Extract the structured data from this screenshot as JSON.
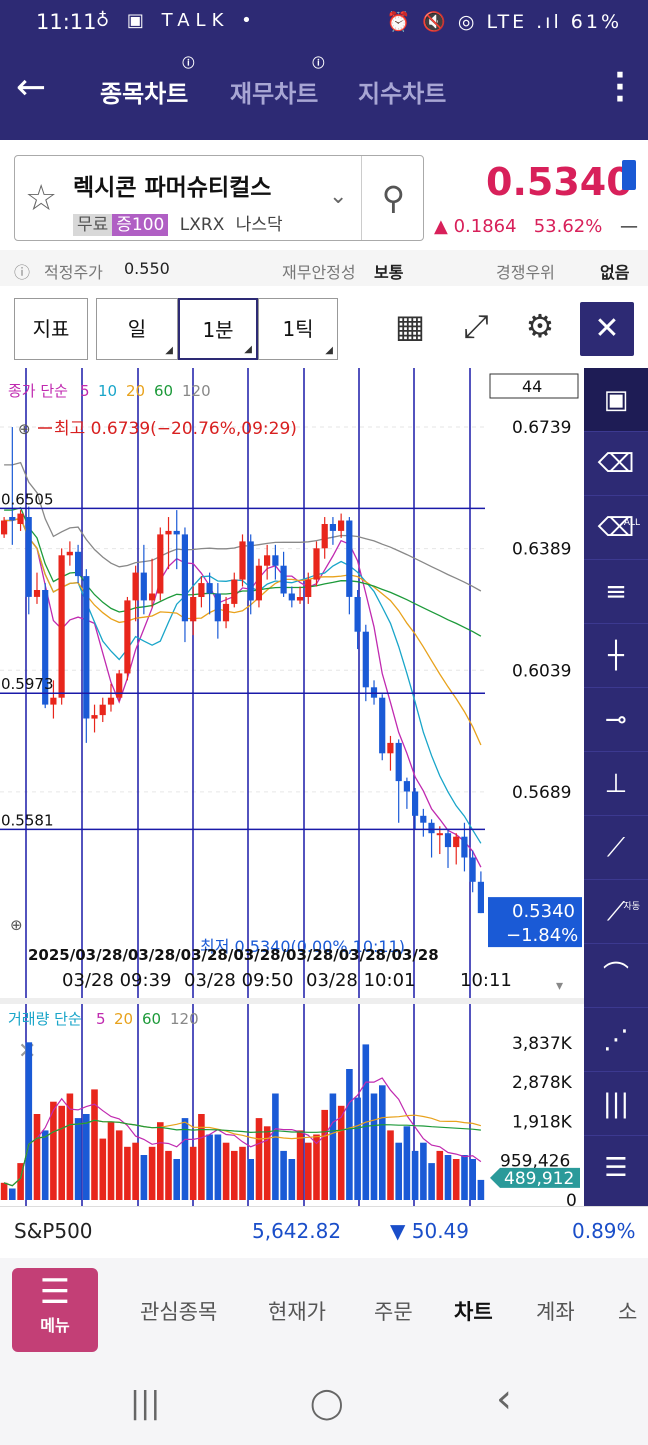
{
  "status": {
    "time": "11:11",
    "left_icons": "♁ ▣ TALK •",
    "right": "⏰ 🔇 ◎ LTE .ıl 61%"
  },
  "header": {
    "tabs": [
      {
        "label": "종목차트",
        "active": true
      },
      {
        "label": "재무차트",
        "active": false
      },
      {
        "label": "지수차트",
        "active": false
      }
    ]
  },
  "stock": {
    "name": "렉시콘 파머슈티컬스",
    "tag1": "무료",
    "tag2": "증100",
    "code": "LXRX",
    "market": "나스닥",
    "price": "0.5340",
    "change": "▲ 0.1864",
    "change_pct": "53.62%",
    "change_dash": "—"
  },
  "info": {
    "fair_label": "적정주가",
    "fair_value": "0.550",
    "stability_label": "재무안정성",
    "stability_value": "보통",
    "compete_label": "경쟁우위",
    "compete_value": "없음"
  },
  "toolbar": {
    "indicator": "지표",
    "day": "일",
    "minute": "1분",
    "tick": "1틱"
  },
  "chart_data": {
    "type": "candlestick",
    "ma_legend": {
      "title": "종가 단순",
      "periods": [
        "5",
        "10",
        "20",
        "60",
        "120"
      ],
      "colors": [
        "#c02ab0",
        "#19a5c9",
        "#e8a21c",
        "#1d9a3a",
        "#888888"
      ]
    },
    "count_box": "44",
    "y_ticks": [
      "0.6739",
      "0.6389",
      "0.6039",
      "0.5689"
    ],
    "ylim": [
      0.5182,
      0.6909
    ],
    "h_lines": [
      {
        "value": 0.6505,
        "label": "0.6505"
      },
      {
        "value": 0.5973,
        "label": "0.5973"
      },
      {
        "value": 0.5581,
        "label": "0.5581"
      }
    ],
    "high_label": "최고 0.6739(−20.76%,09:29)",
    "current_price": "0.5340",
    "current_pct": "−1.84%",
    "date_overlap": "2025/03/28/03/28/03/28/03/28/03/28/03/28/03/28",
    "low_overlap": "최저 0.5340(0.00%,10:11)",
    "x_labels": [
      "03/28 09:39",
      "03/28 09:50",
      "03/28 10:01",
      "10:11"
    ],
    "candles": [
      [
        0.643,
        0.647,
        0.642,
        0.648
      ],
      [
        0.648,
        0.647,
        0.64,
        0.6739
      ],
      [
        0.646,
        0.649,
        0.644,
        0.65
      ],
      [
        0.648,
        0.625,
        0.62,
        0.651
      ],
      [
        0.625,
        0.627,
        0.623,
        0.632
      ],
      [
        0.627,
        0.594,
        0.593,
        0.629
      ],
      [
        0.594,
        0.596,
        0.59,
        0.601
      ],
      [
        0.596,
        0.637,
        0.594,
        0.639
      ],
      [
        0.637,
        0.638,
        0.634,
        0.641
      ],
      [
        0.638,
        0.631,
        0.629,
        0.64
      ],
      [
        0.631,
        0.59,
        0.583,
        0.633
      ],
      [
        0.59,
        0.591,
        0.586,
        0.594
      ],
      [
        0.591,
        0.594,
        0.589,
        0.596
      ],
      [
        0.594,
        0.596,
        0.592,
        0.6
      ],
      [
        0.596,
        0.603,
        0.595,
        0.604
      ],
      [
        0.603,
        0.624,
        0.601,
        0.625
      ],
      [
        0.624,
        0.632,
        0.618,
        0.634
      ],
      [
        0.632,
        0.624,
        0.62,
        0.64
      ],
      [
        0.624,
        0.626,
        0.622,
        0.636
      ],
      [
        0.626,
        0.643,
        0.624,
        0.645
      ],
      [
        0.643,
        0.644,
        0.633,
        0.648
      ],
      [
        0.644,
        0.643,
        0.633,
        0.65
      ],
      [
        0.643,
        0.618,
        0.612,
        0.645
      ],
      [
        0.618,
        0.625,
        0.614,
        0.628
      ],
      [
        0.625,
        0.629,
        0.622,
        0.631
      ],
      [
        0.629,
        0.626,
        0.62,
        0.632
      ],
      [
        0.626,
        0.618,
        0.613,
        0.629
      ],
      [
        0.618,
        0.623,
        0.616,
        0.625
      ],
      [
        0.623,
        0.63,
        0.622,
        0.632
      ],
      [
        0.63,
        0.641,
        0.628,
        0.643
      ],
      [
        0.641,
        0.624,
        0.62,
        0.643
      ],
      [
        0.624,
        0.634,
        0.622,
        0.636
      ],
      [
        0.634,
        0.637,
        0.63,
        0.64
      ],
      [
        0.637,
        0.634,
        0.63,
        0.64
      ],
      [
        0.634,
        0.626,
        0.625,
        0.638
      ],
      [
        0.626,
        0.624,
        0.622,
        0.628
      ],
      [
        0.624,
        0.625,
        0.623,
        0.628
      ],
      [
        0.625,
        0.63,
        0.623,
        0.632
      ],
      [
        0.63,
        0.639,
        0.628,
        0.641
      ],
      [
        0.639,
        0.646,
        0.636,
        0.648
      ],
      [
        0.646,
        0.644,
        0.64,
        0.648
      ],
      [
        0.644,
        0.647,
        0.642,
        0.649
      ],
      [
        0.647,
        0.625,
        0.62,
        0.648
      ],
      [
        0.625,
        0.615,
        0.61,
        0.627
      ],
      [
        0.615,
        0.599,
        0.595,
        0.617
      ],
      [
        0.599,
        0.596,
        0.594,
        0.601
      ],
      [
        0.596,
        0.58,
        0.578,
        0.597
      ],
      [
        0.58,
        0.583,
        0.575,
        0.585
      ],
      [
        0.583,
        0.572,
        0.56,
        0.584
      ],
      [
        0.572,
        0.569,
        0.564,
        0.573
      ],
      [
        0.569,
        0.562,
        0.558,
        0.57
      ],
      [
        0.562,
        0.56,
        0.556,
        0.564
      ],
      [
        0.56,
        0.557,
        0.55,
        0.561
      ],
      [
        0.557,
        0.557,
        0.551,
        0.559
      ],
      [
        0.557,
        0.553,
        0.547,
        0.558
      ],
      [
        0.553,
        0.556,
        0.548,
        0.557
      ],
      [
        0.556,
        0.55,
        0.546,
        0.56
      ],
      [
        0.55,
        0.543,
        0.54,
        0.552
      ],
      [
        0.543,
        0.534,
        0.534,
        0.546
      ]
    ],
    "volume_legend": {
      "title": "거래량 단순",
      "periods": [
        "5",
        "20",
        "60",
        "120"
      ],
      "colors": [
        "#c02ab0",
        "#e8a21c",
        "#1d9a3a",
        "#888888"
      ]
    },
    "volume_ticks": [
      "3,837K",
      "2,878K",
      "1,918K",
      "959,426",
      "0"
    ],
    "volume_current": "489,912",
    "volume_max": 4200000,
    "volumes": [
      420000,
      280000,
      900000,
      3850000,
      2100000,
      1700000,
      2400000,
      2300000,
      2600000,
      2000000,
      2100000,
      2700000,
      1500000,
      1900000,
      1700000,
      1300000,
      1400000,
      1100000,
      1300000,
      1900000,
      1200000,
      1000000,
      2000000,
      1300000,
      2100000,
      1600000,
      1600000,
      1400000,
      1200000,
      1300000,
      1000000,
      2000000,
      1800000,
      2600000,
      1200000,
      1000000,
      1700000,
      1400000,
      1600000,
      2200000,
      2600000,
      2300000,
      3200000,
      2500000,
      3800000,
      2600000,
      2800000,
      1700000,
      1400000,
      1800000,
      1200000,
      1400000,
      900000,
      1200000,
      1100000,
      1000000,
      1100000,
      1000000,
      490000
    ]
  },
  "index": {
    "name": "S&P500",
    "value": "5,642.82",
    "change": "▼ 50.49",
    "pct": "0.89%"
  },
  "menu": {
    "label": "메뉴",
    "items": [
      {
        "label": "관심종목",
        "active": false
      },
      {
        "label": "현재가",
        "active": false
      },
      {
        "label": "주문",
        "active": false
      },
      {
        "label": "차트",
        "active": true
      },
      {
        "label": "계좌",
        "active": false
      },
      {
        "label": "소",
        "active": false
      }
    ]
  },
  "navbar": {
    "recent": "|||",
    "home": "◯",
    "back": "‹"
  }
}
